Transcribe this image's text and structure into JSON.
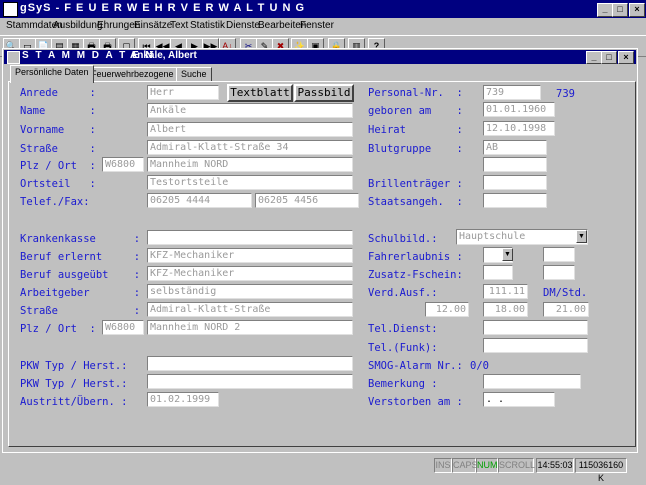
{
  "app": {
    "title": "gSyS - F E U E R W E H R V E R W A L T U N G",
    "min": "_",
    "max": "□",
    "close": "×"
  },
  "menu": [
    "Stammdaten",
    "Ausbildung",
    "Ehrungen",
    "Einsätze",
    "Text",
    "Statistik",
    "Dienste",
    "Bearbeiten",
    "Fenster"
  ],
  "toolbar": {
    "icons": [
      "search-icon",
      "window-icon",
      "document-icon",
      "copy-icon",
      "card-icon",
      "print-icon",
      "printer-icon",
      "folder-icon",
      "first-icon",
      "prev-fast-icon",
      "prev-icon",
      "next-icon",
      "next-fast-icon",
      "last-icon",
      "sort-icon",
      "cut-icon",
      "edit-icon",
      "cross-icon",
      "wizard-icon",
      "form-icon",
      "lock-icon",
      "save-icon",
      "help-icon"
    ],
    "glyphs": [
      "🔍",
      "▭",
      "📄",
      "▤",
      "▦",
      "🖶",
      "🖶",
      "▢",
      "⏮",
      "◀◀",
      "◀",
      "▶",
      "▶▶",
      "⏭",
      "A↓",
      "✂",
      "✎",
      "✖",
      "✨",
      "▣",
      "🔒",
      "▥",
      "?"
    ]
  },
  "child": {
    "title": "S T A M M D A T E N",
    "record": "Ankäle, Albert"
  },
  "tabs": [
    "Persönliche Daten",
    "Feuerwehrbezogene Daten",
    "Suche"
  ],
  "left": {
    "anrede_lbl": "Anrede     :",
    "anrede": "Herr",
    "name_lbl": "Name       :",
    "name": "Ankäle",
    "vorname_lbl": "Vorname    :",
    "vorname": "Albert",
    "strasse_lbl": "Straße     :",
    "strasse": "Admiral-Klatt-Straße 34",
    "plz_lbl": "Plz / Ort  :",
    "plz": "W6800",
    "ort": "Mannheim NORD",
    "ortsteil_lbl": "Ortsteil   :",
    "ortsteil": "Testortsteile",
    "telfax_lbl": "Telef./Fax:",
    "tel": "06205 4444",
    "fax": "06205 4456"
  },
  "buttons": {
    "textblatt": "Textblatt",
    "passbild": "Passbild"
  },
  "right": {
    "personal_lbl": "Personal-Nr.  :",
    "personal": "739",
    "personal_disp": "739",
    "geboren_lbl": "geboren am    :",
    "geboren": "01.01.1960",
    "heirat_lbl": "Heirat        :",
    "heirat": "12.10.1998",
    "blut_lbl": "Blutgruppe    :",
    "blut": "AB",
    "brille_lbl": "Brillenträger :",
    "staat_lbl": "Staatsangeh.  :"
  },
  "left2": {
    "kk_lbl": "Krankenkasse      :",
    "beruf_lbl": "Beruf erlernt     :",
    "beruf": "KFZ-Mechaniker",
    "ausgeuebt_lbl": "Beruf ausgeübt    :",
    "ausgeuebt": "KFZ-Mechaniker",
    "ag_lbl": "Arbeitgeber       :",
    "ag": "selbständig",
    "str_lbl": "Straße            :",
    "str": "Admiral-Klatt-Straße",
    "plz_lbl": "Plz / Ort  :",
    "plz": "W6800",
    "ort": "Mannheim NORD 2"
  },
  "right2": {
    "schul_lbl": "Schulbild.:",
    "schul": "Hauptschule",
    "fahr_lbl": "Fahrerlaubnis :",
    "zusatz_lbl": "Zusatz-Fschein:",
    "verd_lbl": "Verd.Ausf.:",
    "verd": "111.11",
    "dm_lbl": "DM/Std.",
    "v1": "12.00",
    "v2": "18.00",
    "v3": "21.00",
    "teldienst_lbl": "Tel.Dienst:",
    "telfunk_lbl": "Tel.(Funk):",
    "smog_lbl": "SMOG-Alarm Nr.:",
    "smog": "0/0",
    "bem_lbl": "Bemerkung :",
    "verst_lbl": "Verstorben am :",
    "verst": " .  ."
  },
  "bottom": {
    "pkw1_lbl": "PKW Typ / Herst.:",
    "pkw2_lbl": "PKW Typ / Herst.:",
    "austritt_lbl": "Austritt/Übern. :",
    "austritt": "01.02.1999"
  },
  "status": {
    "ins": "INS",
    "caps": "CAPS",
    "num": "NUM",
    "scroll": "SCROLL",
    "time": "14:55:03",
    "mem": "115036160 K"
  }
}
